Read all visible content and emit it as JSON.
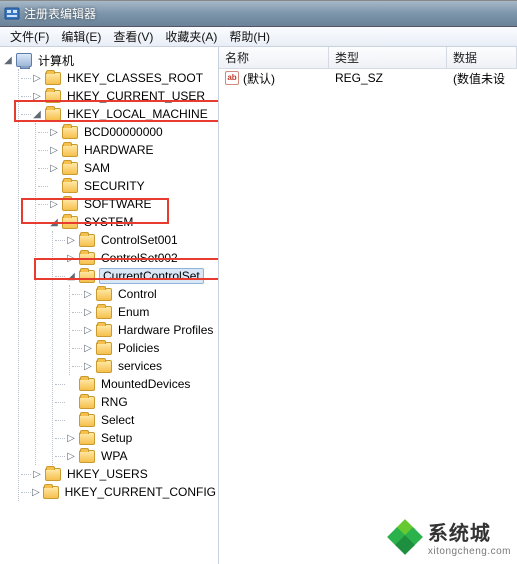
{
  "window": {
    "title": "注册表编辑器"
  },
  "menu": {
    "file": "文件(F)",
    "edit": "编辑(E)",
    "view": "查看(V)",
    "favorites": "收藏夹(A)",
    "help": "帮助(H)"
  },
  "columns": {
    "name": "名称",
    "type": "类型",
    "data": "数据"
  },
  "list": {
    "rows": [
      {
        "name": "(默认)",
        "type": "REG_SZ",
        "data": "(数值未设"
      }
    ]
  },
  "tree": {
    "root": "计算机",
    "hkcr": "HKEY_CLASSES_ROOT",
    "hkcu": "HKEY_CURRENT_USER",
    "hklm": "HKEY_LOCAL_MACHINE",
    "hklm_children": {
      "bcd": "BCD00000000",
      "hardware": "HARDWARE",
      "sam": "SAM",
      "security": "SECURITY",
      "software": "SOFTWARE",
      "system": "SYSTEM"
    },
    "system_children": {
      "cs001": "ControlSet001",
      "cs002": "ControlSet002",
      "ccs": "CurrentControlSet",
      "mounted": "MountedDevices",
      "rng": "RNG",
      "select": "Select",
      "setup": "Setup",
      "wpa": "WPA"
    },
    "ccs_children": {
      "control": "Control",
      "enum": "Enum",
      "hwprofiles": "Hardware Profiles",
      "policies": "Policies",
      "services": "services"
    },
    "hku": "HKEY_USERS",
    "hkcc": "HKEY_CURRENT_CONFIG"
  },
  "watermark": {
    "cn": "系统城",
    "en": "xitongcheng.com"
  },
  "glyphs": {
    "collapsed": "▷",
    "expanded": "◢"
  },
  "icons": {
    "ab": "ab"
  }
}
